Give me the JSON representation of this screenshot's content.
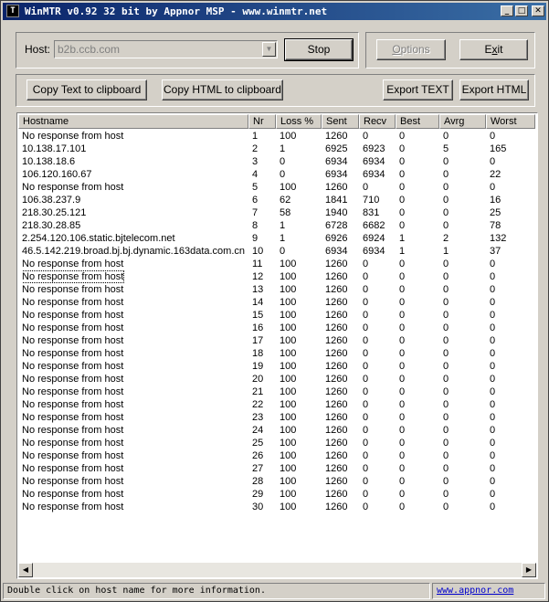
{
  "window": {
    "title": "WinMTR v0.92 32 bit by Appnor MSP - www.winmtr.net",
    "min_glyph": "_",
    "max_glyph": "□",
    "close_glyph": "✕"
  },
  "host": {
    "label": "Host:",
    "value": "b2b.ccb.com"
  },
  "buttons": {
    "stop": "Stop",
    "options": "Options",
    "exit": "Exit",
    "copy_text": "Copy Text to clipboard",
    "copy_html": "Copy HTML to clipboard",
    "export_text": "Export TEXT",
    "export_html": "Export HTML"
  },
  "table": {
    "columns": [
      "Hostname",
      "Nr",
      "Loss %",
      "Sent",
      "Recv",
      "Best",
      "Avrg",
      "Worst"
    ],
    "rows": [
      [
        "No response from host",
        "1",
        "100",
        "1260",
        "0",
        "0",
        "0",
        "0"
      ],
      [
        "10.138.17.101",
        "2",
        "1",
        "6925",
        "6923",
        "0",
        "5",
        "165"
      ],
      [
        "10.138.18.6",
        "3",
        "0",
        "6934",
        "6934",
        "0",
        "0",
        "0"
      ],
      [
        "106.120.160.67",
        "4",
        "0",
        "6934",
        "6934",
        "0",
        "0",
        "22"
      ],
      [
        "No response from host",
        "5",
        "100",
        "1260",
        "0",
        "0",
        "0",
        "0"
      ],
      [
        "106.38.237.9",
        "6",
        "62",
        "1841",
        "710",
        "0",
        "0",
        "16"
      ],
      [
        "218.30.25.121",
        "7",
        "58",
        "1940",
        "831",
        "0",
        "0",
        "25"
      ],
      [
        "218.30.28.85",
        "8",
        "1",
        "6728",
        "6682",
        "0",
        "0",
        "78"
      ],
      [
        "2.254.120.106.static.bjtelecom.net",
        "9",
        "1",
        "6926",
        "6924",
        "1",
        "2",
        "132"
      ],
      [
        "46.5.142.219.broad.bj.bj.dynamic.163data.com.cn",
        "10",
        "0",
        "6934",
        "6934",
        "1",
        "1",
        "37"
      ],
      [
        "No response from host",
        "11",
        "100",
        "1260",
        "0",
        "0",
        "0",
        "0"
      ],
      [
        "No response from host",
        "12",
        "100",
        "1260",
        "0",
        "0",
        "0",
        "0"
      ],
      [
        "No response from host",
        "13",
        "100",
        "1260",
        "0",
        "0",
        "0",
        "0"
      ],
      [
        "No response from host",
        "14",
        "100",
        "1260",
        "0",
        "0",
        "0",
        "0"
      ],
      [
        "No response from host",
        "15",
        "100",
        "1260",
        "0",
        "0",
        "0",
        "0"
      ],
      [
        "No response from host",
        "16",
        "100",
        "1260",
        "0",
        "0",
        "0",
        "0"
      ],
      [
        "No response from host",
        "17",
        "100",
        "1260",
        "0",
        "0",
        "0",
        "0"
      ],
      [
        "No response from host",
        "18",
        "100",
        "1260",
        "0",
        "0",
        "0",
        "0"
      ],
      [
        "No response from host",
        "19",
        "100",
        "1260",
        "0",
        "0",
        "0",
        "0"
      ],
      [
        "No response from host",
        "20",
        "100",
        "1260",
        "0",
        "0",
        "0",
        "0"
      ],
      [
        "No response from host",
        "21",
        "100",
        "1260",
        "0",
        "0",
        "0",
        "0"
      ],
      [
        "No response from host",
        "22",
        "100",
        "1260",
        "0",
        "0",
        "0",
        "0"
      ],
      [
        "No response from host",
        "23",
        "100",
        "1260",
        "0",
        "0",
        "0",
        "0"
      ],
      [
        "No response from host",
        "24",
        "100",
        "1260",
        "0",
        "0",
        "0",
        "0"
      ],
      [
        "No response from host",
        "25",
        "100",
        "1260",
        "0",
        "0",
        "0",
        "0"
      ],
      [
        "No response from host",
        "26",
        "100",
        "1260",
        "0",
        "0",
        "0",
        "0"
      ],
      [
        "No response from host",
        "27",
        "100",
        "1260",
        "0",
        "0",
        "0",
        "0"
      ],
      [
        "No response from host",
        "28",
        "100",
        "1260",
        "0",
        "0",
        "0",
        "0"
      ],
      [
        "No response from host",
        "29",
        "100",
        "1260",
        "0",
        "0",
        "0",
        "0"
      ],
      [
        "No response from host",
        "30",
        "100",
        "1260",
        "0",
        "0",
        "0",
        "0"
      ]
    ]
  },
  "status": {
    "hint": "Double click on host name for more information.",
    "link": "www.appnor.com"
  }
}
